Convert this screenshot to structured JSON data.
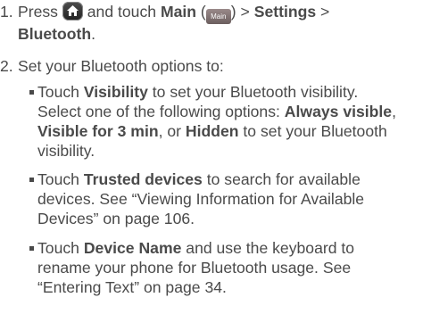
{
  "step1": {
    "num": "1.",
    "t1": "Press",
    "t2": "and touch",
    "main": "Main",
    "open": "(",
    "main_icon": "Main",
    "close": ")",
    "sep1": ">",
    "settings": "Settings",
    "sep2": ">",
    "bluetooth": "Bluetooth",
    "period": "."
  },
  "step2": {
    "num": "2.",
    "text": "Set your Bluetooth options to:"
  },
  "bullet1": {
    "touch": "Touch",
    "visibility": "Visibility",
    "l1": "to set your Bluetooth visibility.",
    "l2a": "Select one of the following options:",
    "always": "Always visible",
    "comma1": ",",
    "visible3": "Visible for 3 min",
    "or": ", or",
    "hidden": "Hidden",
    "l3b": "to set your Bluetooth",
    "l4": "visibility."
  },
  "bullet2": {
    "touch": "Touch",
    "trusted": "Trusted devices",
    "l1": "to search for available",
    "l2": "devices. See “Viewing Information for Available",
    "l3": "Devices” on page 106."
  },
  "bullet3": {
    "touch": "Touch",
    "device": "Device Name",
    "l1": "and use the keyboard to",
    "l2": "rename your phone for Bluetooth usage. See",
    "l3": "“Entering Text” on page 34."
  }
}
